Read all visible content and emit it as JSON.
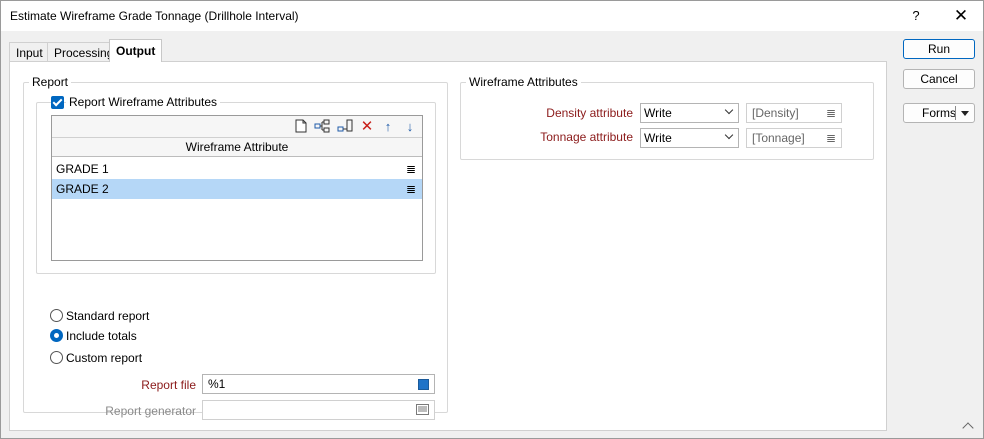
{
  "window": {
    "title": "Estimate Wireframe Grade Tonnage (Drillhole Interval)",
    "help_glyph": "?",
    "close_glyph": "✕"
  },
  "tabs": [
    {
      "label": "Input",
      "active": false
    },
    {
      "label": "Processing",
      "active": false
    },
    {
      "label": "Output",
      "active": true
    }
  ],
  "report": {
    "group_label": "Report",
    "wireframe_checkbox_label": "Report Wireframe Attributes",
    "wireframe_checked": true,
    "list_header": "Wireframe Attribute",
    "toolbar_icons": [
      "new-icon",
      "insert-icon",
      "insert-after-icon",
      "delete-icon",
      "move-up-icon",
      "move-down-icon"
    ],
    "rows": [
      {
        "label": "GRADE 1",
        "selected": false
      },
      {
        "label": "GRADE 2",
        "selected": true
      }
    ],
    "row_icon": "≣",
    "radios": [
      {
        "label": "Standard report",
        "selected": false
      },
      {
        "label": "Include totals",
        "selected": true
      },
      {
        "label": "Custom report",
        "selected": false
      }
    ],
    "report_file_label": "Report file",
    "report_file_value": "%1",
    "report_generator_label": "Report generator",
    "report_generator_value": ""
  },
  "wireframe_attributes": {
    "group_label": "Wireframe Attributes",
    "density_label": "Density attribute",
    "density_mode": "Write",
    "density_value": "[Density]",
    "tonnage_label": "Tonnage attribute",
    "tonnage_mode": "Write",
    "tonnage_value": "[Tonnage]"
  },
  "buttons": {
    "run": "Run",
    "cancel": "Cancel",
    "forms": "Forms"
  },
  "colors": {
    "accent": "#0067c0",
    "label_red": "#8b1a1a",
    "selection": "#b5d7f7"
  }
}
